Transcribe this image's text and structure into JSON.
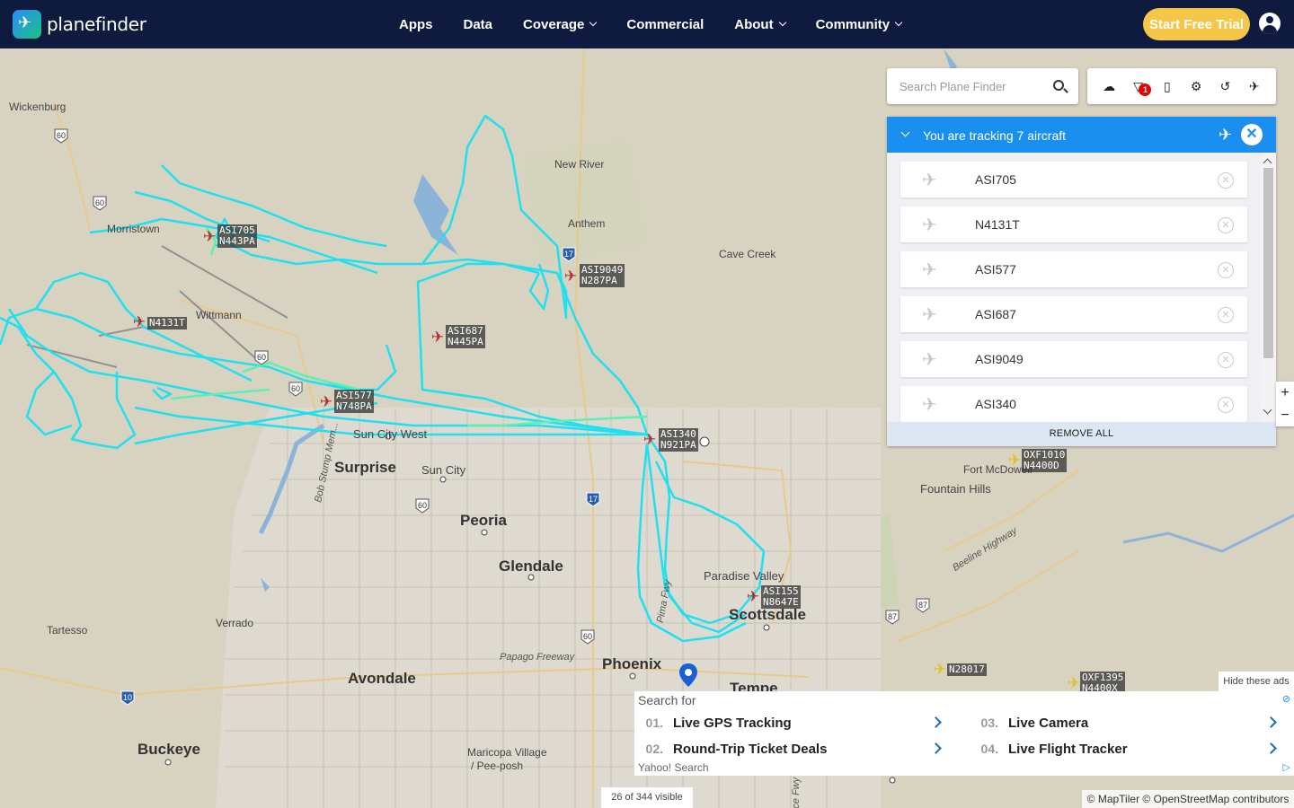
{
  "header": {
    "logo_text": "planefinder",
    "nav": [
      {
        "label": "Apps",
        "dropdown": false
      },
      {
        "label": "Data",
        "dropdown": false
      },
      {
        "label": "Coverage",
        "dropdown": true
      },
      {
        "label": "Commercial",
        "dropdown": false
      },
      {
        "label": "About",
        "dropdown": true
      },
      {
        "label": "Community",
        "dropdown": true
      }
    ],
    "trial_button": "Start Free Trial",
    "accent": "#0e1b3f",
    "trial_color": "#f5c748"
  },
  "search": {
    "placeholder": "Search Plane Finder"
  },
  "toolbar": {
    "icons": [
      "cloud-upload-icon",
      "filter-icon",
      "bookmark-icon",
      "settings-icon",
      "history-icon",
      "ar-plane-icon"
    ],
    "filter_badge": "1"
  },
  "tracking": {
    "title": "You are tracking 7 aircraft",
    "items": [
      "ASI705",
      "N4131T",
      "ASI577",
      "ASI687",
      "ASI9049",
      "ASI340"
    ],
    "remove_all": "REMOVE ALL",
    "header_color": "#1a8ff0"
  },
  "map": {
    "places": {
      "wickenburg": "Wickenburg",
      "morristown": "Morristown",
      "wittmann": "Wittmann",
      "new_river": "New River",
      "anthem": "Anthem",
      "cave_creek": "Cave Creek",
      "sun_city_west": "Sun City West",
      "surprise": "Surprise",
      "sun_city": "Sun City",
      "peoria": "Peoria",
      "glendale": "Glendale",
      "paradise_valley": "Paradise Valley",
      "scottsdale": "Scottsdale",
      "fort_mcdowell": "Fort McDowell",
      "fountain_hills": "Fountain Hills",
      "tartesso": "Tartesso",
      "verrado": "Verrado",
      "phoenix": "Phoenix",
      "avondale": "Avondale",
      "tempe": "Tempe",
      "buckeye": "Buckeye",
      "maricopa_village": "Maricopa Village",
      "pee_posh": "/ Pee-posh",
      "papago_freeway": "Papago Freeway",
      "beeline_highway": "Beeline Highway",
      "bob_stump": "Bob Stump Mem...",
      "pima_freeway": "Pima Fwy",
      "pima_road": "Price Fwy"
    },
    "shields": [
      "60",
      "60",
      "17",
      "60",
      "17",
      "60",
      "60",
      "87",
      "87",
      "10",
      "60"
    ],
    "aircraft": [
      {
        "callsign": "ASI705",
        "reg": "N443PA",
        "color": "#b03030",
        "tracked": true
      },
      {
        "callsign": "N4131T",
        "reg": "",
        "color": "#b03030",
        "tracked": true
      },
      {
        "callsign": "ASI9049",
        "reg": "N287PA",
        "color": "#b03030",
        "tracked": true
      },
      {
        "callsign": "ASI687",
        "reg": "N445PA",
        "color": "#b03030",
        "tracked": true
      },
      {
        "callsign": "ASI577",
        "reg": "N748PA",
        "color": "#b03030",
        "tracked": true
      },
      {
        "callsign": "ASI340",
        "reg": "N921PA",
        "color": "#b03030",
        "tracked": true
      },
      {
        "callsign": "ASI155",
        "reg": "N8647E",
        "color": "#b03030",
        "tracked": true
      },
      {
        "callsign": "OXF1010",
        "reg": "N4400D",
        "color": "#e0c020",
        "tracked": false
      },
      {
        "callsign": "N28017",
        "reg": "",
        "color": "#e0c020",
        "tracked": false
      },
      {
        "callsign": "OXF1395",
        "reg": "N4400X",
        "color": "#e0c020",
        "tracked": false
      }
    ],
    "track_color": "#1fe0f0",
    "visible_count": "26 of 344 visible",
    "attribution": "© MapTiler © OpenStreetMap contributors"
  },
  "ad": {
    "hide": "Hide these ads",
    "search_for": "Search for",
    "items": [
      {
        "num": "01.",
        "text": "Live GPS Tracking"
      },
      {
        "num": "03.",
        "text": "Live Camera"
      },
      {
        "num": "02.",
        "text": "Round-Trip Ticket Deals"
      },
      {
        "num": "04.",
        "text": "Live Flight Tracker"
      }
    ],
    "footer": "Yahoo! Search"
  }
}
